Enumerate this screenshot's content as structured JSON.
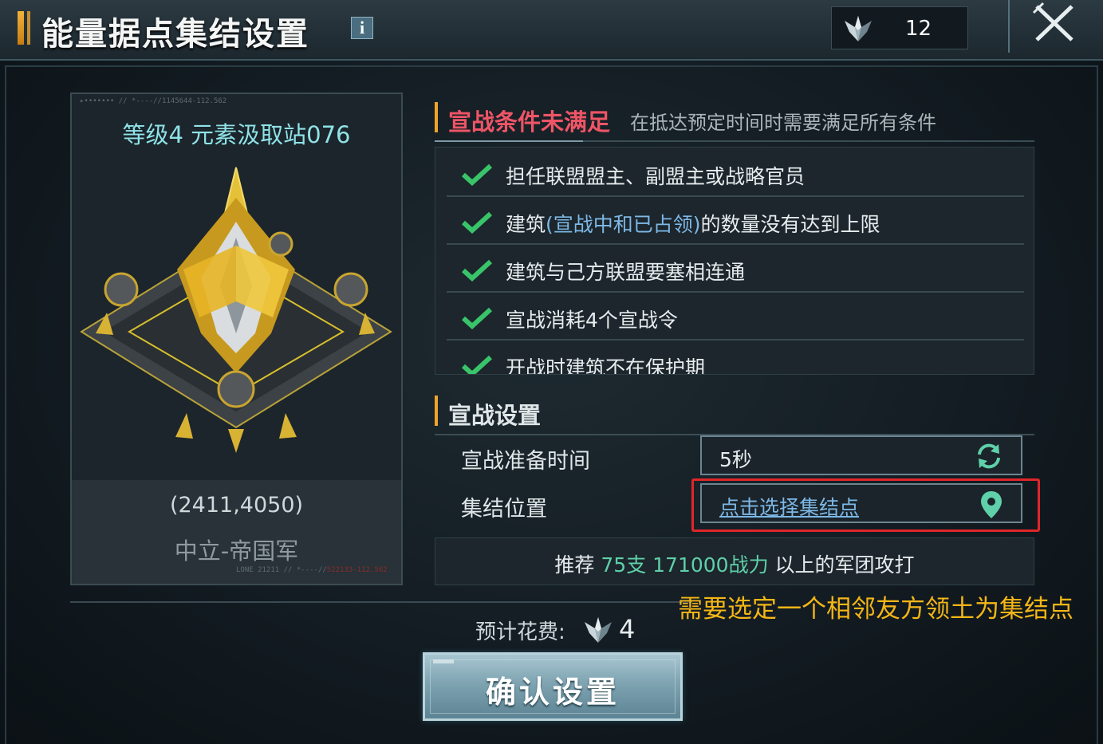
{
  "header": {
    "title": "能量据点集结设置",
    "info_icon": "i",
    "currency": {
      "icon": "war-token-icon",
      "value": "12"
    },
    "close_icon": "close-icon"
  },
  "building": {
    "level_name": "等级4 元素汲取站076",
    "coords": "(2411,4050)",
    "owner": "中立-帝国军",
    "top_deco": "▸•••••••   // *----//1145644-112.562",
    "bottom_deco": "LONE 21211 // *----//",
    "bottom_deco_red": "522133-112.562"
  },
  "conditions": {
    "title": "宣战条件未满足",
    "description": "在抵达预定时间时需要满足所有条件",
    "items": [
      {
        "text": "担任联盟盟主、副盟主或战略官员",
        "met": true
      },
      {
        "text_before": "建筑",
        "text_blue": "(宣战中和已占领)",
        "text_after": "的数量没有达到上限",
        "met": true
      },
      {
        "text": "建筑与己方联盟要塞相连通",
        "met": true
      },
      {
        "text": "宣战消耗4个宣战令",
        "met": true
      },
      {
        "text": "开战时建筑不在保护期",
        "met": true
      }
    ]
  },
  "settings": {
    "title": "宣战设置",
    "prep_time_label": "宣战准备时间",
    "prep_time_value": "5秒",
    "rally_label": "集结位置",
    "rally_link": "点击选择集结点"
  },
  "recommend": {
    "prefix": "推荐",
    "highlight": "75支 171000战力",
    "suffix": "以上的军团攻打"
  },
  "annotation": "需要选定一个相邻友方领土为集结点",
  "cost": {
    "label": "预计花费:",
    "value": "4"
  },
  "confirm_button": "确认设置",
  "colors": {
    "accent": "#f0a52a",
    "alert": "#ee5566",
    "highlight": "#5fd0a9",
    "link": "#7db8e6",
    "annotation": "#f5b616",
    "red_box": "#e0262a"
  }
}
